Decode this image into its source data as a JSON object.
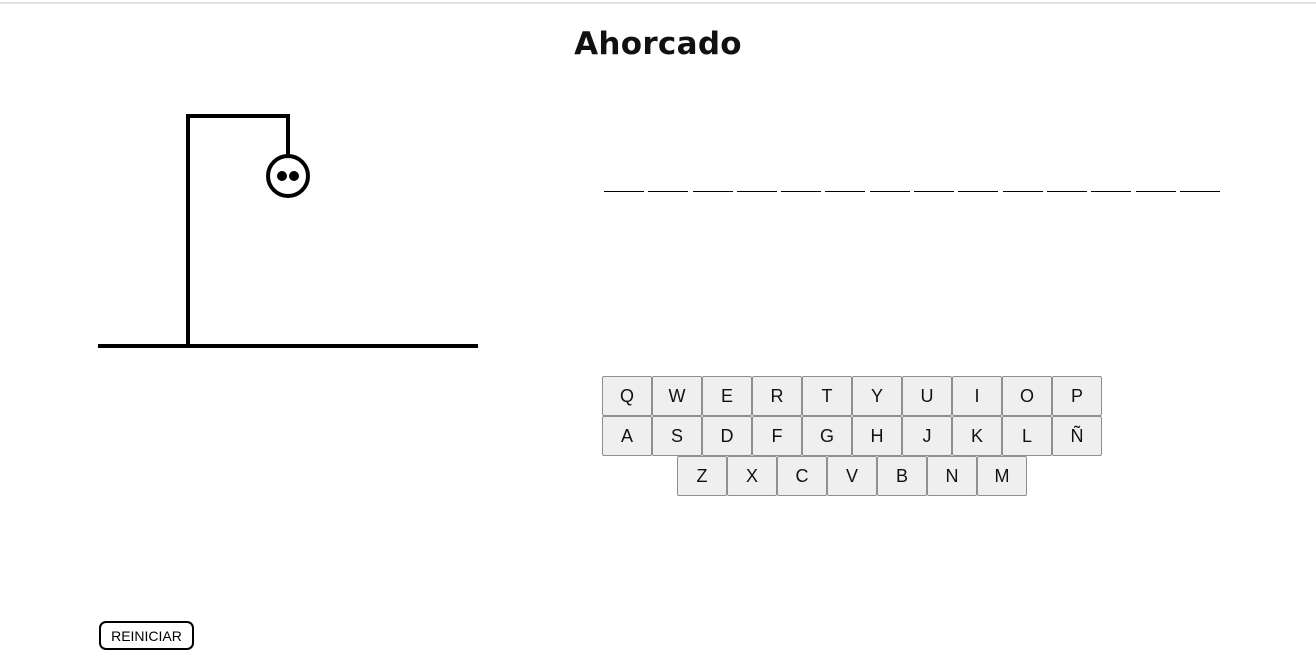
{
  "page": {
    "title": "Ahorcado"
  },
  "hangman": {
    "parts_drawn": [
      "ground",
      "post",
      "beam",
      "rope",
      "head",
      "eyes"
    ]
  },
  "word": {
    "length": 14,
    "revealed": [
      "",
      "",
      "",
      "",
      "",
      "",
      "",
      "",
      "",
      "",
      "",
      "",
      "",
      ""
    ]
  },
  "keyboard": {
    "rows": [
      [
        "Q",
        "W",
        "E",
        "R",
        "T",
        "Y",
        "U",
        "I",
        "O",
        "P"
      ],
      [
        "A",
        "S",
        "D",
        "F",
        "G",
        "H",
        "J",
        "K",
        "L",
        "Ñ"
      ],
      [
        "Z",
        "X",
        "C",
        "V",
        "B",
        "N",
        "M"
      ]
    ]
  },
  "controls": {
    "reset_label": "REINICIAR"
  },
  "colors": {
    "ink": "#000000",
    "key_background": "#efefef",
    "key_border": "#8f8f8f",
    "page_background": "#ffffff"
  }
}
